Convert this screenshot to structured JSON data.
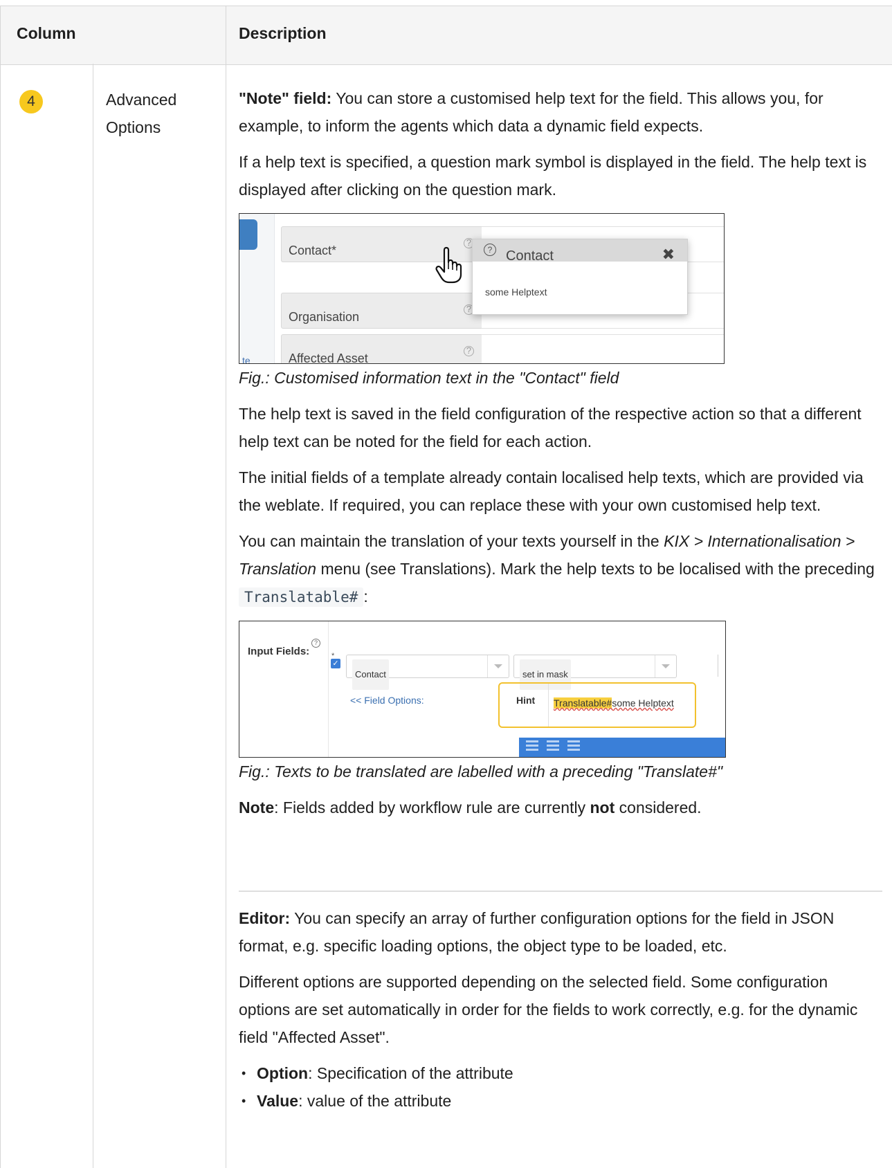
{
  "table": {
    "header": {
      "column": "Column",
      "description": "Description"
    },
    "row": {
      "badge": "4",
      "column_name": "Advanced Options",
      "note_field": {
        "label": "\"Note\" field:",
        "text": " You can store a customised help text for the field. This allows you, for example, to inform the agents which data a dynamic field expects."
      },
      "para_help": "If a help text is specified, a question mark symbol is displayed in the field. The help text is displayed after clicking on the question mark.",
      "figure1": {
        "fields": [
          "Contact*",
          "Organisation",
          "Affected Asset"
        ],
        "sidebar_fragment": "te",
        "popup_title": "Contact",
        "popup_text": "some Helptext",
        "caption": "Fig.: Customised information text in the \"Contact\" field"
      },
      "para_saved": "The help text is saved in the field configuration of the respective action so that a different help text can be noted for the field for each action.",
      "para_initial": "The initial fields of a template already contain localised help texts, which are provided via the weblate. If required, you can replace these with your own customised help text.",
      "para_translation": {
        "t1": "You can maintain the translation of your texts yourself in the ",
        "menu_path": "KIX > Internationalisation > Translation",
        "t2": " menu (see Translations). Mark the help texts to be localised with the preceding ",
        "code": "Translatable#",
        "t3": ":"
      },
      "figure2": {
        "input_fields_label": "Input Fields:",
        "required_marker": "*",
        "select1": "Contact",
        "select2": "set in mask",
        "field_options_link": "<< Field Options:",
        "hint_label": "Hint",
        "hint_prefix": "Translatable#",
        "hint_text": "some Helptext",
        "caption": "Fig.: Texts to be translated are labelled with a preceding \"Translate#\""
      },
      "note": {
        "label": "Note",
        "t1": ": Fields added by workflow rule are currently ",
        "bold": "not",
        "t2": " considered."
      },
      "editor": {
        "label": "Editor:",
        "text": " You can specify an array of further configuration options for the field in JSON format, e.g. specific loading options, the object type to be loaded, etc."
      },
      "para_options": "Different options are supported depending on the selected field. Some configuration options are set automatically in order for the fields to work correctly, e.g. for the dynamic field \"Affected Asset\".",
      "options_list": [
        {
          "bold": "Option",
          "text": ": Specification of the attribute"
        },
        {
          "bold": "Value",
          "text": ": value of the attribute"
        }
      ]
    }
  },
  "colors": {
    "badge": "#f7c81e",
    "highlight": "#f7cf3f",
    "accent_blue": "#3a7fd8"
  }
}
